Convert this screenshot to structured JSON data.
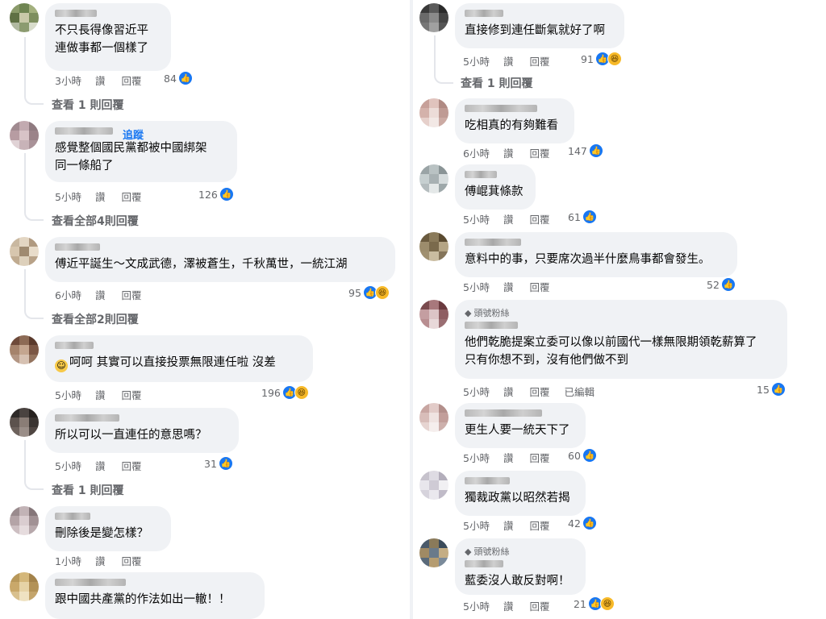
{
  "left_column": {
    "comments": [
      {
        "follow": "",
        "badge": "",
        "lines": [
          "不只長得像習近平",
          "連做事都一個樣了"
        ],
        "time": "3小時",
        "like": "讚",
        "reply": "回覆",
        "count": "84",
        "haha": false
      },
      {
        "follow": "追蹤",
        "badge": "",
        "lines": [
          "感覺整個國民黨都被中國綁架",
          "同一條船了"
        ],
        "time": "5小時",
        "like": "讚",
        "reply": "回覆",
        "count": "126",
        "haha": false
      },
      {
        "follow": "",
        "badge": "",
        "lines": [
          "傅近平誕生～文成武德，澤被蒼生，千秋萬世，一統江湖"
        ],
        "time": "6小時",
        "like": "讚",
        "reply": "回覆",
        "count": "95",
        "haha": true
      },
      {
        "follow": "",
        "badge": "",
        "lines": [
          "呵呵 其實可以直接投票無限連任啦 沒差"
        ],
        "time": "5小時",
        "like": "讚",
        "reply": "回覆",
        "count": "196",
        "haha": true
      },
      {
        "follow": "",
        "badge": "",
        "lines": [
          "所以可以一直連任的意思嗎？"
        ],
        "time": "5小時",
        "like": "讚",
        "reply": "回覆",
        "count": "31",
        "haha": false
      },
      {
        "follow": "",
        "badge": "",
        "lines": [
          "刪除後是變怎樣？"
        ],
        "time": "1小時",
        "like": "讚",
        "reply": "回覆",
        "count": "",
        "haha": false
      },
      {
        "follow": "",
        "badge": "",
        "lines": [
          "跟中國共產黨的作法如出一轍！！"
        ],
        "time": "",
        "like": "",
        "reply": "",
        "count": "",
        "haha": false
      }
    ],
    "view_replies": [
      "查看 1 則回覆",
      "查看全部4則回覆",
      "查看全部2則回覆",
      "查看 1 則回覆"
    ]
  },
  "right_column": {
    "comments": [
      {
        "badge": "",
        "lines": [
          "直接修到連任斷氣就好了啊"
        ],
        "time": "5小時",
        "like": "讚",
        "reply": "回覆",
        "count": "91",
        "haha": true,
        "edited": ""
      },
      {
        "badge": "",
        "lines": [
          "吃相真的有夠難看"
        ],
        "time": "6小時",
        "like": "讚",
        "reply": "回覆",
        "count": "147",
        "haha": false,
        "edited": ""
      },
      {
        "badge": "",
        "lines": [
          "傅崐萁條款"
        ],
        "time": "5小時",
        "like": "讚",
        "reply": "回覆",
        "count": "61",
        "haha": false,
        "edited": ""
      },
      {
        "badge": "",
        "lines": [
          "意料中的事，只要席次過半什麼鳥事都會發生。"
        ],
        "time": "5小時",
        "like": "讚",
        "reply": "回覆",
        "count": "52",
        "haha": false,
        "edited": ""
      },
      {
        "badge": "頭號粉絲",
        "lines": [
          "他們乾脆提案立委可以像以前國代一樣無限期領乾薪算了",
          "只有你想不到，沒有他們做不到"
        ],
        "time": "5小時",
        "like": "讚",
        "reply": "回覆",
        "count": "15",
        "haha": false,
        "edited": "已編輯"
      },
      {
        "badge": "",
        "lines": [
          "更生人要一統天下了"
        ],
        "time": "5小時",
        "like": "讚",
        "reply": "回覆",
        "count": "60",
        "haha": false,
        "edited": ""
      },
      {
        "badge": "",
        "lines": [
          "獨裁政黨以昭然若揭"
        ],
        "time": "5小時",
        "like": "讚",
        "reply": "回覆",
        "count": "42",
        "haha": false,
        "edited": ""
      },
      {
        "badge": "頭號粉絲",
        "lines": [
          "藍委沒人敢反對啊！"
        ],
        "time": "5小時",
        "like": "讚",
        "reply": "回覆",
        "count": "21",
        "haha": true,
        "edited": ""
      }
    ],
    "view_replies": [
      "查看 1 則回覆"
    ]
  },
  "icons": {
    "like": "thumbs-up-icon",
    "haha": "laughing-face-icon",
    "fan": "diamond-badge-icon",
    "inline_emoji": "smiling-face-icon"
  },
  "colors": {
    "bubble": "#f0f2f5",
    "meta": "#65676b",
    "like_blue": "#1877f2",
    "haha_yellow": "#f7b928"
  }
}
